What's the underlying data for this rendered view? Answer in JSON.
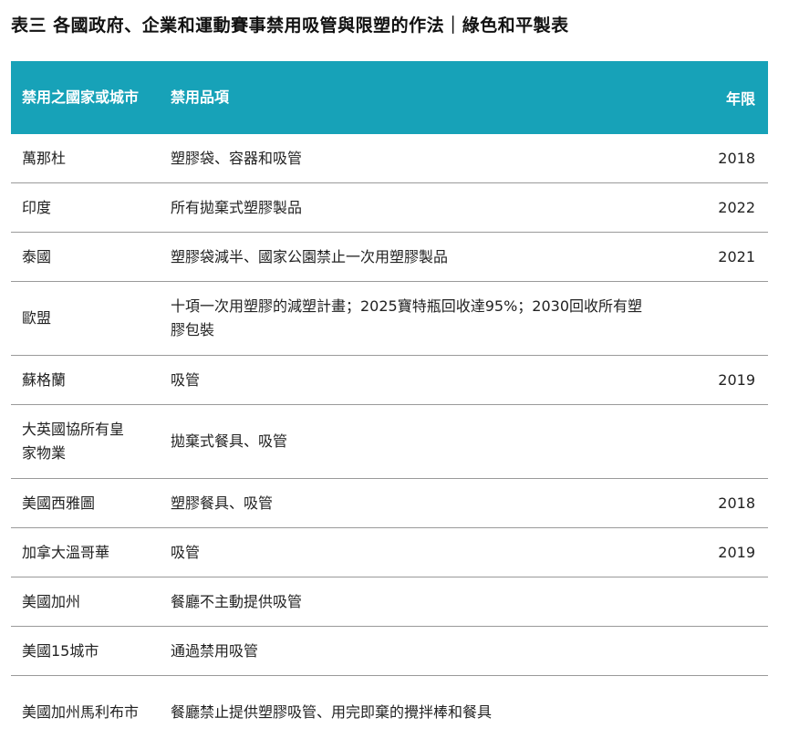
{
  "title": "表三 各國政府、企業和運動賽事禁用吸管與限塑的作法｜綠色和平製表",
  "header_color": "#17a2b8",
  "table": {
    "headers": {
      "region": "禁用之國家或城市",
      "items": "禁用品項",
      "year": "年限"
    },
    "rows": [
      {
        "region": "萬那杜",
        "items": "塑膠袋、容器和吸管",
        "year": "2018"
      },
      {
        "region": "印度",
        "items": "所有拋棄式塑膠製品",
        "year": "2022"
      },
      {
        "region": "泰國",
        "items": "塑膠袋減半、國家公園禁止一次用塑膠製品",
        "year": "2021"
      },
      {
        "region": "歐盟",
        "items": "十項一次用塑膠的減塑計畫；2025寶特瓶回收達95%；2030回收所有塑膠包裝",
        "year": ""
      },
      {
        "region": "蘇格蘭",
        "items": "吸管",
        "year": "2019"
      },
      {
        "region": "大英國協所有皇家物業",
        "items": "拋棄式餐具、吸管",
        "year": ""
      },
      {
        "region": "美國西雅圖",
        "items": "塑膠餐具、吸管",
        "year": "2018"
      },
      {
        "region": "加拿大溫哥華",
        "items": "吸管",
        "year": "2019"
      },
      {
        "region": "美國加州",
        "items": "餐廳不主動提供吸管",
        "year": ""
      },
      {
        "region": "美國15城市",
        "items": "通過禁用吸管",
        "year": ""
      },
      {
        "region": "美國加州馬利布市",
        "items": "餐廳禁止提供塑膠吸管、用完即棄的攪拌棒和餐具",
        "year": ""
      }
    ]
  }
}
